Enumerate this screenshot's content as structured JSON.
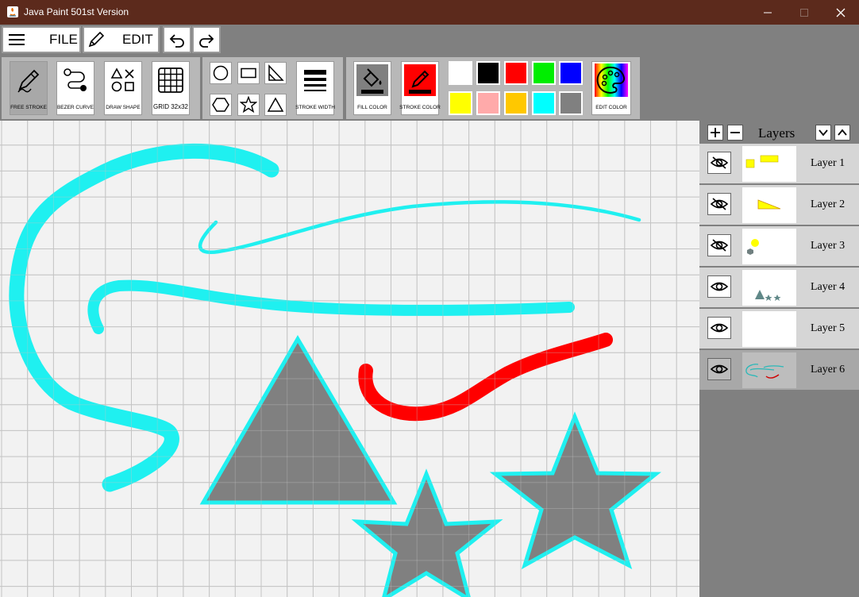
{
  "window": {
    "title": "Java Paint 501st Version",
    "titlebar_color": "#5c2a1c"
  },
  "menubar": {
    "file_label": "FILE",
    "edit_label": "EDIT",
    "icons": [
      "menu-icon",
      "pencil-icon",
      "undo-icon",
      "redo-icon"
    ]
  },
  "toolbar": {
    "tools": [
      {
        "label": "FREE STROKE",
        "icon": "free-stroke-icon",
        "selected": true
      },
      {
        "label": "BEZER CURVE",
        "icon": "bezier-curve-icon"
      },
      {
        "label": "DRAW SHAPE",
        "icon": "shapes-icon"
      },
      {
        "label": "GRID 32x32",
        "icon": "grid-icon"
      }
    ],
    "shapes": [
      "circle",
      "rectangle",
      "right-triangle",
      "hexagon",
      "star",
      "triangle"
    ],
    "stroke_width_label": "STROKE WIDTH",
    "fill_color_label": "FILL COLOR",
    "fill_color": "#808080",
    "stroke_color_label": "STROKE COLOR",
    "stroke_color": "#ff0000",
    "palette": [
      "#ffffff",
      "#000000",
      "#ff0000",
      "#00ee00",
      "#0000ff",
      "#ffff00",
      "#ffaaaa",
      "#ffc800",
      "#00ffff",
      "#808080"
    ],
    "edit_color_label": "EDIT COLOR"
  },
  "layers": {
    "title": "Layers",
    "items": [
      {
        "name": "Layer 1",
        "visible": false,
        "selected": false
      },
      {
        "name": "Layer 2",
        "visible": false,
        "selected": false
      },
      {
        "name": "Layer 3",
        "visible": false,
        "selected": false
      },
      {
        "name": "Layer 4",
        "visible": true,
        "selected": false
      },
      {
        "name": "Layer 5",
        "visible": true,
        "selected": false
      },
      {
        "name": "Layer 6",
        "visible": true,
        "selected": true
      }
    ]
  },
  "canvas": {
    "grid": true,
    "background": "#f2f2f2",
    "grid_color": "#c4c4c4",
    "stroke_cyan": "#1ff0f0",
    "stroke_red": "#ff0000",
    "shape_fill": "#808080"
  }
}
